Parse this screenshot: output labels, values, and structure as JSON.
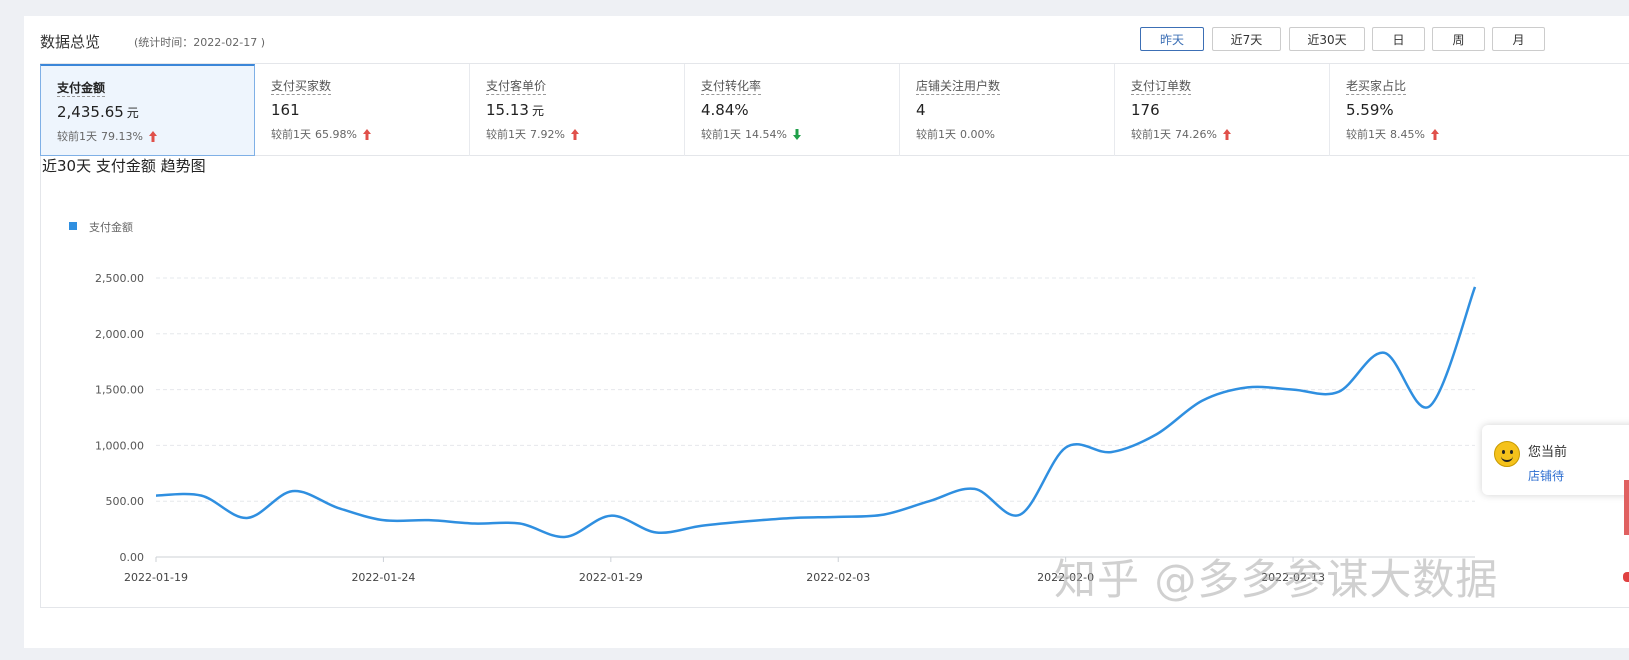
{
  "header": {
    "title": "数据总览",
    "subtitle": "(统计时间：2022-02-17 )"
  },
  "range_buttons": [
    {
      "label": "昨天",
      "active": true
    },
    {
      "label": "近7天",
      "active": false
    },
    {
      "label": "近30天",
      "active": false
    },
    {
      "label": "日",
      "active": false
    },
    {
      "label": "周",
      "active": false
    },
    {
      "label": "月",
      "active": false
    }
  ],
  "metrics": [
    {
      "label": "支付金额",
      "value": "2,435.65",
      "unit": "元",
      "compare_label": "较前1天",
      "compare_pct": "79.13%",
      "trend": "up"
    },
    {
      "label": "支付买家数",
      "value": "161",
      "unit": "",
      "compare_label": "较前1天",
      "compare_pct": "65.98%",
      "trend": "up"
    },
    {
      "label": "支付客单价",
      "value": "15.13",
      "unit": "元",
      "compare_label": "较前1天",
      "compare_pct": "7.92%",
      "trend": "up"
    },
    {
      "label": "支付转化率",
      "value": "4.84%",
      "unit": "",
      "compare_label": "较前1天",
      "compare_pct": "14.54%",
      "trend": "down"
    },
    {
      "label": "店铺关注用户数",
      "value": "4",
      "unit": "",
      "compare_label": "较前1天",
      "compare_pct": "0.00%",
      "trend": "none"
    },
    {
      "label": "支付订单数",
      "value": "176",
      "unit": "",
      "compare_label": "较前1天",
      "compare_pct": "74.26%",
      "trend": "up"
    },
    {
      "label": "老买家占比",
      "value": "5.59%",
      "unit": "",
      "compare_label": "较前1天",
      "compare_pct": "8.45%",
      "trend": "up"
    }
  ],
  "colors": {
    "up": "#e0504a",
    "down": "#21a04a",
    "line": "#2f8fe0",
    "active_border": "#3b86d8"
  },
  "chart_data": {
    "type": "line",
    "title": "近30天 支付金额 趋势图",
    "legend_position": "top-left",
    "series": [
      {
        "name": "支付金额",
        "values": [
          550,
          550,
          350,
          590,
          440,
          330,
          330,
          300,
          300,
          180,
          370,
          220,
          280,
          320,
          350,
          360,
          380,
          500,
          610,
          380,
          980,
          940,
          1100,
          1400,
          1520,
          1500,
          1480,
          1830,
          1350,
          2420
        ]
      }
    ],
    "x": [
      "2022-01-19",
      "2022-01-20",
      "2022-01-21",
      "2022-01-22",
      "2022-01-23",
      "2022-01-24",
      "2022-01-25",
      "2022-01-26",
      "2022-01-27",
      "2022-01-28",
      "2022-01-29",
      "2022-01-30",
      "2022-01-31",
      "2022-02-01",
      "2022-02-02",
      "2022-02-03",
      "2022-02-04",
      "2022-02-05",
      "2022-02-06",
      "2022-02-07",
      "2022-02-08",
      "2022-02-09",
      "2022-02-10",
      "2022-02-11",
      "2022-02-12",
      "2022-02-13",
      "2022-02-14",
      "2022-02-15",
      "2022-02-16",
      "2022-02-17"
    ],
    "x_tick_labels": [
      "2022-01-19",
      "2022-01-24",
      "2022-01-29",
      "2022-02-03",
      "2022-02-0",
      "2022-02-13"
    ],
    "y_tick_labels": [
      "0.00",
      "500.00",
      "1,000.00",
      "1,500.00",
      "2,000.00",
      "2,500.00"
    ],
    "ylim": [
      0,
      2500
    ],
    "grid": true
  },
  "watermark": "知乎 @多多参谋大数据",
  "popup": {
    "line1": "您当前",
    "line2": "店铺待"
  }
}
